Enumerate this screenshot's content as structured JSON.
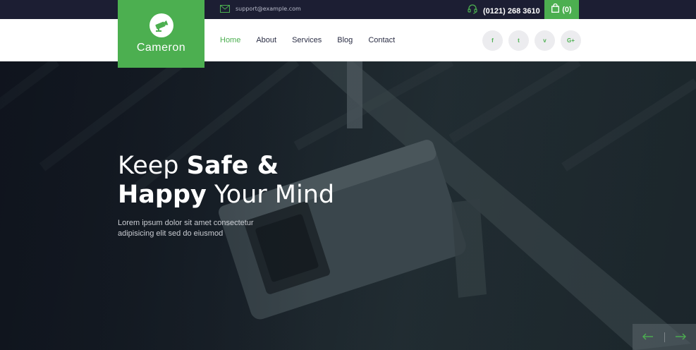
{
  "brand": {
    "name": "Cameron",
    "logo_icon": "cctv-camera-icon"
  },
  "topbar": {
    "email": "support@example.com",
    "phone": "(0121) 268 3610",
    "cart_count": "(0)"
  },
  "nav": {
    "items": [
      {
        "label": "Home",
        "active": true
      },
      {
        "label": "About"
      },
      {
        "label": "Services"
      },
      {
        "label": "Blog"
      },
      {
        "label": "Contact"
      }
    ]
  },
  "social": [
    "f",
    "t",
    "v",
    "G+"
  ],
  "hero": {
    "line1_normal": "Keep ",
    "line1_bold": "Safe &",
    "line2_bold": "Happy",
    "line2_normal": " Your Mind",
    "subtitle": "Lorem ipsum dolor sit amet consectetur adipisicing elit sed do eiusmod"
  },
  "colors": {
    "accent": "#4caf50",
    "dark": "#1c1e33"
  }
}
